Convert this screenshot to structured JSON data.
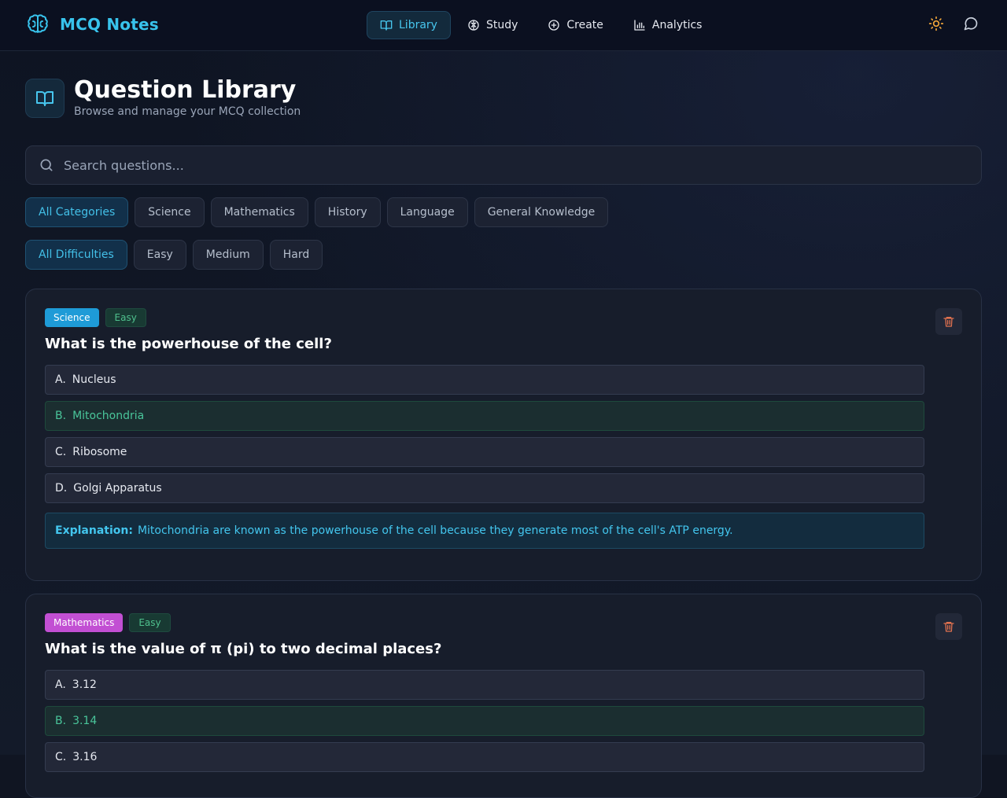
{
  "app": {
    "name": "MCQ Notes"
  },
  "nav": {
    "items": [
      {
        "label": "Library",
        "icon": "book-icon",
        "active": true
      },
      {
        "label": "Study",
        "icon": "brain-icon",
        "active": false
      },
      {
        "label": "Create",
        "icon": "plus-circle-icon",
        "active": false
      },
      {
        "label": "Analytics",
        "icon": "bar-chart-icon",
        "active": false
      }
    ]
  },
  "top_actions": {
    "theme_icon": "sun-icon",
    "chat_icon": "message-icon"
  },
  "header": {
    "title": "Question Library",
    "subtitle": "Browse and manage your MCQ collection"
  },
  "search": {
    "placeholder": "Search questions...",
    "value": ""
  },
  "category_filters": [
    "All Categories",
    "Science",
    "Mathematics",
    "History",
    "Language",
    "General Knowledge"
  ],
  "difficulty_filters": [
    "All Difficulties",
    "Easy",
    "Medium",
    "Hard"
  ],
  "questions": [
    {
      "category": "Science",
      "difficulty": "Easy",
      "text": "What is the powerhouse of the cell?",
      "options": [
        {
          "letter": "A.",
          "text": "Nucleus"
        },
        {
          "letter": "B.",
          "text": "Mitochondria"
        },
        {
          "letter": "C.",
          "text": "Ribosome"
        },
        {
          "letter": "D.",
          "text": "Golgi Apparatus"
        }
      ],
      "correct": "B",
      "explanation_label": "Explanation:",
      "explanation": "Mitochondria are known as the powerhouse of the cell because they generate most of the cell's ATP energy."
    },
    {
      "category": "Mathematics",
      "difficulty": "Easy",
      "text": "What is the value of π (pi) to two decimal places?",
      "options": [
        {
          "letter": "A.",
          "text": "3.12"
        },
        {
          "letter": "B.",
          "text": "3.14"
        },
        {
          "letter": "C.",
          "text": "3.16"
        }
      ],
      "correct": "B"
    }
  ],
  "colors": {
    "accent": "#38c3ec",
    "background": "#101522",
    "correct": "#49c59a",
    "science_badge": "#1e9bd7",
    "math_badge": "#c24fd3",
    "delete": "#e0714f"
  }
}
